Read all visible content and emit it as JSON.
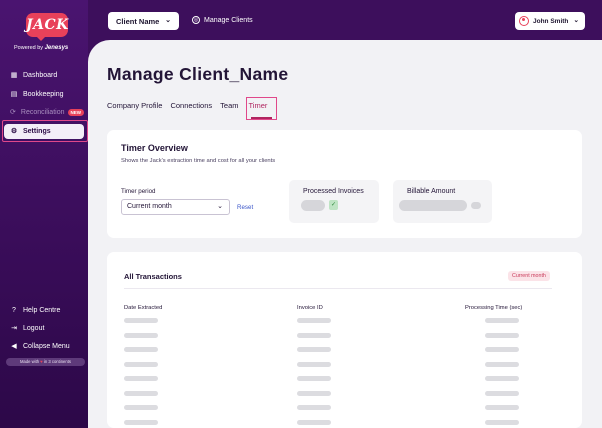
{
  "sidebar": {
    "logo_text": "JACK",
    "powered_prefix": "Powered by",
    "powered_brand": "Jenesys",
    "items": [
      {
        "label": "Dashboard",
        "icon": "grid-icon"
      },
      {
        "label": "Bookkeeping",
        "icon": "book-icon"
      },
      {
        "label": "Reconciliation",
        "icon": "reconcile-icon",
        "badge": "NEW"
      },
      {
        "label": "Settings",
        "icon": "gear-icon"
      }
    ],
    "bottom_items": [
      {
        "label": "Help Centre",
        "icon": "help-icon"
      },
      {
        "label": "Logout",
        "icon": "logout-icon"
      },
      {
        "label": "Collapse Menu",
        "icon": "collapse-icon"
      }
    ],
    "made_with": {
      "prefix": "Made with",
      "suffix": "in 3 continents"
    }
  },
  "header": {
    "client_select": "Client Name",
    "manage_clients": "Manage Clients",
    "user_name": "John Smith"
  },
  "main": {
    "title": "Manage Client_Name",
    "tabs": [
      {
        "label": "Company Profile"
      },
      {
        "label": "Connections"
      },
      {
        "label": "Team"
      },
      {
        "label": "Timer",
        "active": true
      }
    ]
  },
  "timer_overview": {
    "title": "Timer Overview",
    "subtitle": "Shows the Jack's extraction time and cost for all your clients",
    "period_label": "Timer period",
    "period_value": "Current month",
    "reset": "Reset",
    "processed_invoices": "Processed Invoices",
    "billable_amount": "Billable Amount"
  },
  "transactions": {
    "title": "All Transactions",
    "badge": "Current month",
    "columns": [
      "Date Extracted",
      "Invoice ID",
      "Processing Time (sec)"
    ],
    "row_count": 8
  },
  "colors": {
    "accent": "#e8415a",
    "highlight": "#e0488a",
    "brand_purple": "#3d0f5c",
    "link": "#3b56c9"
  }
}
